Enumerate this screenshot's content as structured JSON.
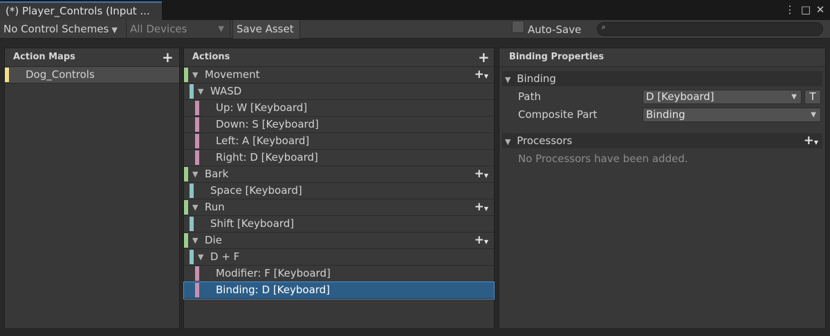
{
  "window": {
    "tab_title": "(*) Player_Controls (Input ...",
    "menu_icon": "⋮",
    "maximize_icon": "□",
    "close_icon": "✕"
  },
  "toolbar": {
    "control_schemes": "No Control Schemes",
    "devices": "All Devices",
    "save_asset": "Save Asset",
    "auto_save": "Auto-Save",
    "search_icon": "🔍",
    "search_value": ""
  },
  "action_maps": {
    "header": "Action Maps",
    "items": [
      "Dog_Controls"
    ]
  },
  "actions": {
    "header": "Actions",
    "rows": [
      {
        "label": "Movement",
        "kind": "action"
      },
      {
        "label": "WASD",
        "kind": "composite"
      },
      {
        "label": "Up: W [Keyboard]",
        "kind": "part"
      },
      {
        "label": "Down: S [Keyboard]",
        "kind": "part"
      },
      {
        "label": "Left: A [Keyboard]",
        "kind": "part"
      },
      {
        "label": "Right: D [Keyboard]",
        "kind": "part"
      },
      {
        "label": "Bark",
        "kind": "action"
      },
      {
        "label": "Space [Keyboard]",
        "kind": "binding"
      },
      {
        "label": "Run",
        "kind": "action"
      },
      {
        "label": "Shift [Keyboard]",
        "kind": "binding"
      },
      {
        "label": "Die",
        "kind": "action"
      },
      {
        "label": "D + F",
        "kind": "composite"
      },
      {
        "label": "Modifier: F [Keyboard]",
        "kind": "part"
      },
      {
        "label": "Binding: D [Keyboard]",
        "kind": "part",
        "selected": true
      }
    ]
  },
  "binding_properties": {
    "header": "Binding Properties",
    "binding_section": "Binding",
    "path_label": "Path",
    "path_value": "D [Keyboard]",
    "t_button": "T",
    "composite_part_label": "Composite Part",
    "composite_part_value": "Binding",
    "processors_section": "Processors",
    "processors_empty": "No Processors have been added."
  },
  "colors": {
    "action_bar": "#9ccf8a",
    "composite_bar": "#8ec3c3",
    "part_bar": "#c98fb1",
    "map_bar": "#f4de87",
    "selection": "#2c5d87"
  }
}
